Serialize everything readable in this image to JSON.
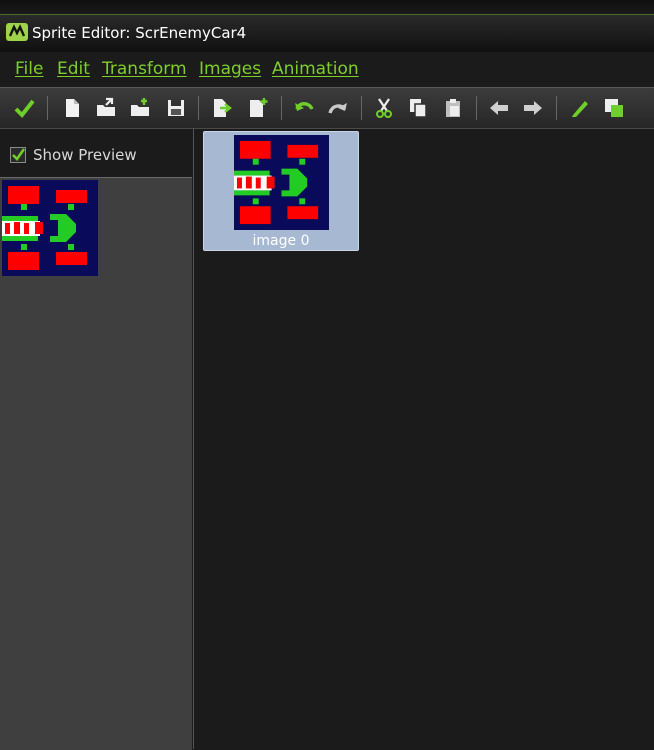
{
  "window": {
    "title": "Sprite Editor: ScrEnemyCar4",
    "app_icon": "gamemaker-logo-icon"
  },
  "menu": {
    "items": [
      {
        "label": "File"
      },
      {
        "label": "Edit"
      },
      {
        "label": "Transform"
      },
      {
        "label": "Images"
      },
      {
        "label": "Animation"
      }
    ]
  },
  "toolbar": {
    "buttons": [
      "confirm-check-icon",
      "new-sprite-icon",
      "open-folder-icon",
      "load-strip-icon",
      "save-icon",
      "create-from-file-icon",
      "add-from-file-icon",
      "undo-icon",
      "redo-icon",
      "cut-icon",
      "copy-icon",
      "paste-icon",
      "move-left-icon",
      "move-right-icon",
      "edit-image-icon",
      "show-background-icon"
    ]
  },
  "preview": {
    "show_preview_label": "Show Preview",
    "checked": true
  },
  "frames": [
    {
      "label": "image 0"
    }
  ],
  "colors": {
    "accent_green": "#7ecf2a",
    "sprite_bg": "#0a0a5a",
    "sprite_red": "#ff0000",
    "sprite_green": "#22cc22",
    "tile_selected": "#a7b8d3"
  }
}
